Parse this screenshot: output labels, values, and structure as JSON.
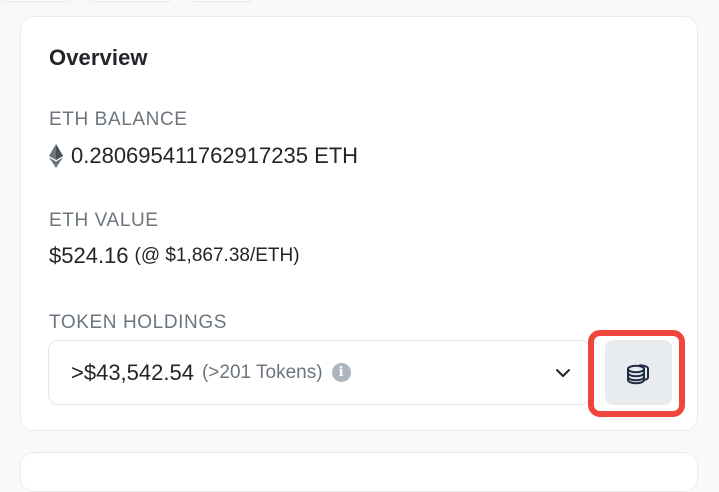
{
  "overview": {
    "title": "Overview",
    "eth_balance": {
      "label": "ETH BALANCE",
      "value": "0.280695411762917235 ETH",
      "icon": "ethereum-icon"
    },
    "eth_value": {
      "label": "ETH VALUE",
      "amount": "$524.16",
      "rate": "(@ $1,867.38/ETH)"
    },
    "token_holdings": {
      "label": "TOKEN HOLDINGS",
      "amount": ">$43,542.54",
      "count": "(>201 Tokens)",
      "info_icon": "info-icon",
      "dropdown_icon": "chevron-down-icon",
      "portfolio_button_icon": "coins-stack-icon"
    }
  },
  "colors": {
    "highlight": "#f0453d",
    "label": "#6c757d",
    "text": "#212529",
    "button_bg": "#e9ecef"
  }
}
